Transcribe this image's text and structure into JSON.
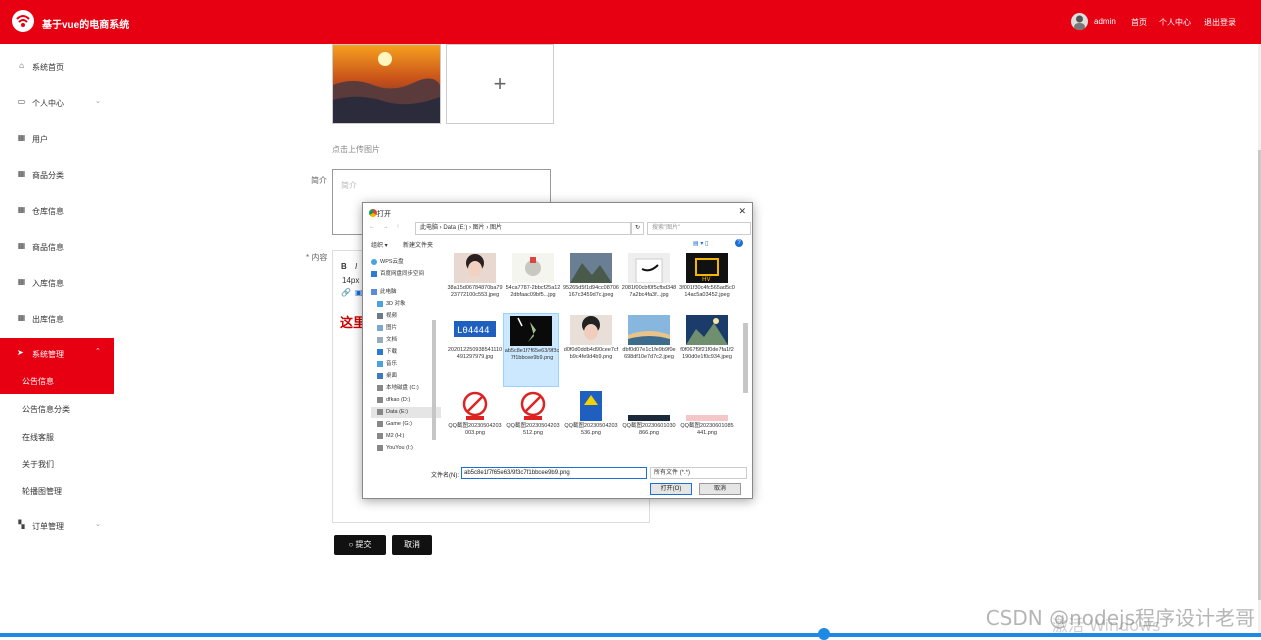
{
  "header": {
    "brand": "基于vue的电商系统",
    "username": "admin",
    "links": [
      "首页",
      "个人中心",
      "退出登录"
    ]
  },
  "sidebar": {
    "items": [
      {
        "label": "系统首页",
        "icon": "home-icon"
      },
      {
        "label": "个人中心",
        "icon": "profile-icon"
      },
      {
        "label": "用户",
        "icon": "grid-icon"
      },
      {
        "label": "商品分类",
        "icon": "grid-icon"
      },
      {
        "label": "仓库信息",
        "icon": "grid-icon"
      },
      {
        "label": "商品信息",
        "icon": "grid-icon"
      },
      {
        "label": "入库信息",
        "icon": "grid-icon"
      },
      {
        "label": "出库信息",
        "icon": "grid-icon"
      },
      {
        "label": "系统管理",
        "icon": "send-icon"
      }
    ],
    "sub_items": [
      "公告信息",
      "公告信息分类",
      "在线客服",
      "关于我们",
      "轮播图管理"
    ],
    "bottom_item": "订单管理"
  },
  "form": {
    "upload_caption": "点击上传图片",
    "intro_label": "简介",
    "intro_placeholder": "简介",
    "content_label": "* 内容",
    "editor_bold": "B",
    "editor_italic": "I",
    "editor_size": "14px",
    "editor_red_text": "这里",
    "submit_label": "提交",
    "cancel_label": "取消"
  },
  "dialog": {
    "title": "打开",
    "address": "此电脑 › Data (E:) › 图片 › 图片",
    "search_placeholder": "搜索\"图片\"",
    "organize": "组织 ▾",
    "new_folder": "新建文件夹",
    "nav": [
      "WPS云盘",
      "百度网盘同步空间",
      "此电脑",
      "3D 对象",
      "视频",
      "图片",
      "文档",
      "下载",
      "音乐",
      "桌面",
      "本地磁盘 (C:)",
      "dfkao (D:)",
      "Data (E:)",
      "Game (G:)",
      "M2 (H:)",
      "YouYou (I:)"
    ],
    "files": [
      "38a15d06784870ba7923772100c553.jpeg",
      "54ca7787-2bbcf25a122dbfaac09bf5...jpg",
      "95265d5f1d94cc08706167c3459d7c.jpeg",
      "2081f00cbf0f5cfbd3487a2bc4fa3f...jpg",
      "3f001f30c4fc565ad5c014ac5a03452.jpeg",
      "202012250938541110491297979.jpg",
      "ab5c8e1f7f65e63/9f3c7f1bbcee9b9.png",
      "d0f0d0ddb4d90cee7cfb9c4fe9d4b9.png",
      "dbf0d07e1c1fe9b9f0e698df10e7d7c2.jpeg",
      "f0f067f9f21f0de7fa1f2190d0e1f0c934.jpeg",
      "QQ截图20230504203003.png",
      "QQ截图20230504203512.png",
      "QQ截图20230504203536.png",
      "QQ截图20230601030866.png",
      "QQ截图20230601085441.png"
    ],
    "filename_label": "文件名(N):",
    "filename_value": "ab5c8e1f7f65e63/9f3c7f1bbcee9b9.png",
    "filetype_value": "所有文件 (*.*)",
    "open_label": "打开(O)",
    "cancel_label": "取消"
  },
  "watermark": "CSDN @nodejs程序设计老哥",
  "activation_text": "激活 Windows"
}
